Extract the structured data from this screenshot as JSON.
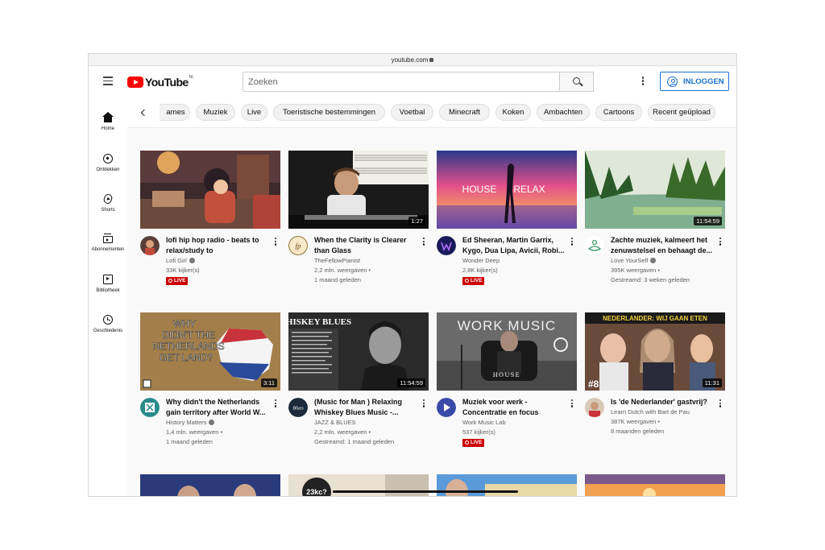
{
  "browser": {
    "url": "youtube.com"
  },
  "header": {
    "logo_text": "YouTube",
    "country_code": "NL",
    "search_placeholder": "Zoeken",
    "login_label": "INLOGGEN"
  },
  "sidebar": {
    "items": [
      {
        "label": "Home",
        "icon": "home-icon"
      },
      {
        "label": "Ontdekken",
        "icon": "compass-icon"
      },
      {
        "label": "Shorts",
        "icon": "shorts-icon"
      },
      {
        "label": "Abonnementen",
        "icon": "subscriptions-icon"
      },
      {
        "label": "Bibliotheek",
        "icon": "library-icon"
      },
      {
        "label": "Geschiedenis",
        "icon": "history-icon"
      }
    ]
  },
  "chips": [
    "ames",
    "Muziek",
    "Live",
    "Toeristische bestemmingen",
    "Voetbal",
    "Minecraft",
    "Koken",
    "Ambachten",
    "Cartoons",
    "Recent geüpload"
  ],
  "live_label": "LIVE",
  "videos": [
    {
      "title": "lofi hip hop radio - beats to relax/study to",
      "channel": "Lofi Girl",
      "verified": true,
      "line2": "33K kijker(s)",
      "line3": "",
      "live": true,
      "duration": ""
    },
    {
      "title": "When the Clarity is Clearer than Glass",
      "channel": "TheFellowPianist",
      "verified": false,
      "line2": "2,2 mln. weergaven •",
      "line3": "1 maand geleden",
      "live": false,
      "duration": "1:27"
    },
    {
      "title": "Ed Sheeran, Martin Garrix, Kygo, Dua Lipa, Avicii, Robi...",
      "channel": "Wonder Deep",
      "verified": false,
      "line2": "2,8K kijker(s)",
      "line3": "",
      "live": true,
      "duration": ""
    },
    {
      "title": "Zachte muziek, kalmeert het zenuwstelsel en behaagt de...",
      "channel": "Love YourSelf",
      "verified": true,
      "line2": "395K weergaven •",
      "line3": "Gestreamd: 3 weken geleden",
      "live": false,
      "duration": "11:54:59"
    },
    {
      "title": "Why didn't the Netherlands gain territory after World W...",
      "channel": "History Matters",
      "verified": true,
      "line2": "1,4 mln. weergaven •",
      "line3": "1 maand geleden",
      "live": false,
      "duration": "3:11"
    },
    {
      "title": "(Music for Man ) Relaxing Whiskey Blues Music -...",
      "channel": "JAZZ & BLUES",
      "verified": false,
      "line2": "2,2 mln. weergaven •",
      "line3": "Gestreamd: 1 maand geleden",
      "live": false,
      "duration": "11:54:59"
    },
    {
      "title": "Muziek voor werk - Concentratie en focus",
      "channel": "Work Music Lab",
      "verified": false,
      "line2": "537 kijker(s)",
      "line3": "",
      "live": true,
      "duration": ""
    },
    {
      "title": "Is 'de Nederlander' gastvrij?",
      "channel": "Learn Dutch with Bart de Pau",
      "verified": false,
      "line2": "387K weergaven •",
      "line3": "8 maanden geleden",
      "live": false,
      "duration": "11:31"
    }
  ],
  "thumb_text": {
    "house": "HOUSE",
    "relax": "RELAX",
    "why": [
      "WHY",
      "DIDN'T THE",
      "NETHERLANDS",
      "GET LAND?"
    ],
    "whiskey": "WHISKEY BLUES",
    "work_music": "WORK MUSIC",
    "house_tv": "HOUSE",
    "nederlander": "NEDERLANDER: WIJ GAAN ETEN",
    "episode": "#8",
    "row3_badge": "23kc?"
  },
  "colors": {
    "accent": "#1a6fd0",
    "live": "#cc0000",
    "logo": "#ff0000"
  }
}
